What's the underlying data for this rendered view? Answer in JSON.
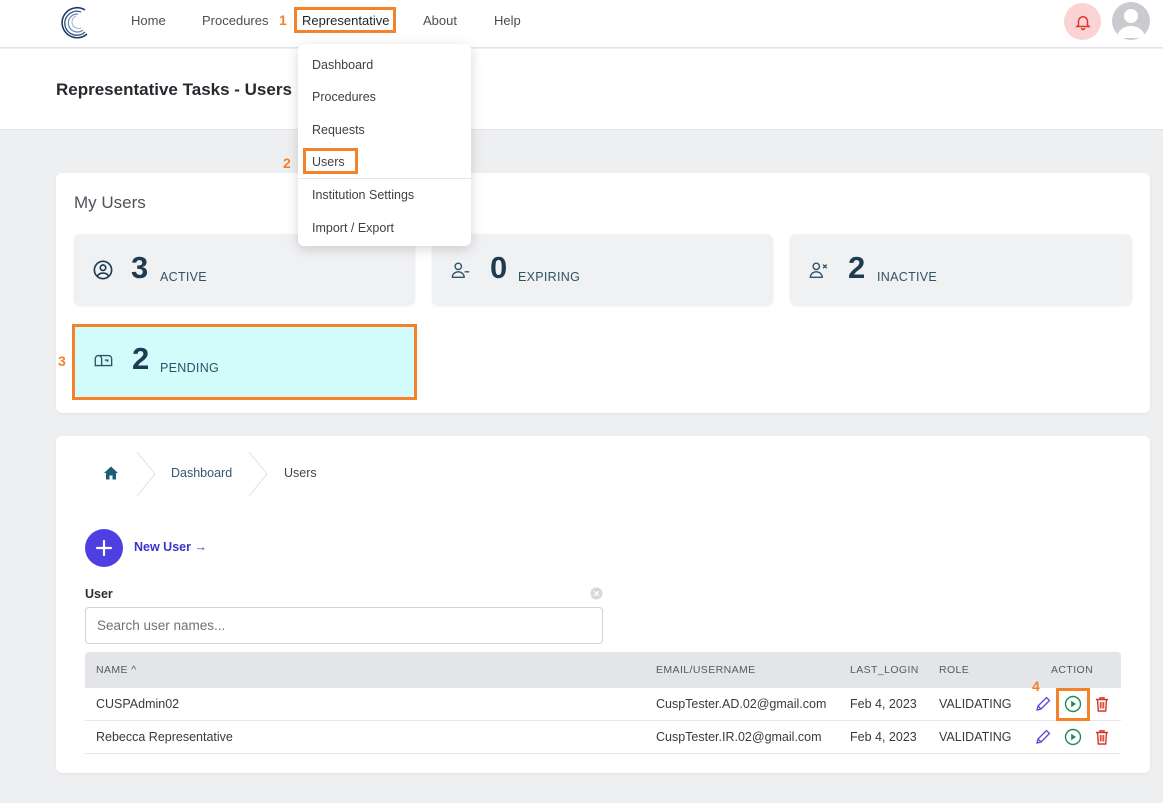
{
  "nav": {
    "home": "Home",
    "procedures": "Procedures",
    "representative": "Representative",
    "about": "About",
    "help": "Help"
  },
  "dropdown": {
    "items": [
      "Dashboard",
      "Procedures",
      "Requests",
      "Users",
      "Institution Settings",
      "Import / Export"
    ]
  },
  "page": {
    "title": "Representative Tasks - Users"
  },
  "my_users": {
    "title": "My Users",
    "stats": [
      {
        "count": "3",
        "label": "ACTIVE",
        "icon": "user-circle-icon"
      },
      {
        "count": "0",
        "label": "EXPIRING",
        "icon": "user-minus-icon"
      },
      {
        "count": "2",
        "label": "INACTIVE",
        "icon": "user-x-icon"
      },
      {
        "count": "2",
        "label": "PENDING",
        "icon": "mailbox-icon"
      }
    ]
  },
  "breadcrumb": {
    "items": [
      "Dashboard",
      "Users"
    ],
    "home_icon": "home-icon"
  },
  "new_user": {
    "label": "New User →"
  },
  "filter": {
    "label": "User",
    "placeholder": "Search user names..."
  },
  "table": {
    "headers": {
      "name": "NAME ^",
      "email": "EMAIL/USERNAME",
      "last_login": "LAST_LOGIN",
      "role": "ROLE",
      "action": "ACTION"
    },
    "rows": [
      {
        "name": "CUSPAdmin02",
        "email": "CuspTester.AD.02@gmail.com",
        "last_login": "Feb 4, 2023",
        "role": "VALIDATING"
      },
      {
        "name": "Rebecca Representative",
        "email": "CuspTester.IR.02@gmail.com",
        "last_login": "Feb 4, 2023",
        "role": "VALIDATING"
      }
    ]
  },
  "annotations": [
    "1",
    "2",
    "3",
    "4"
  ],
  "colors": {
    "accent": "#4d3fe0",
    "annotation": "#f4822a",
    "pending_bg": "#d2fbfb",
    "stat_number": "#1d3b51"
  }
}
